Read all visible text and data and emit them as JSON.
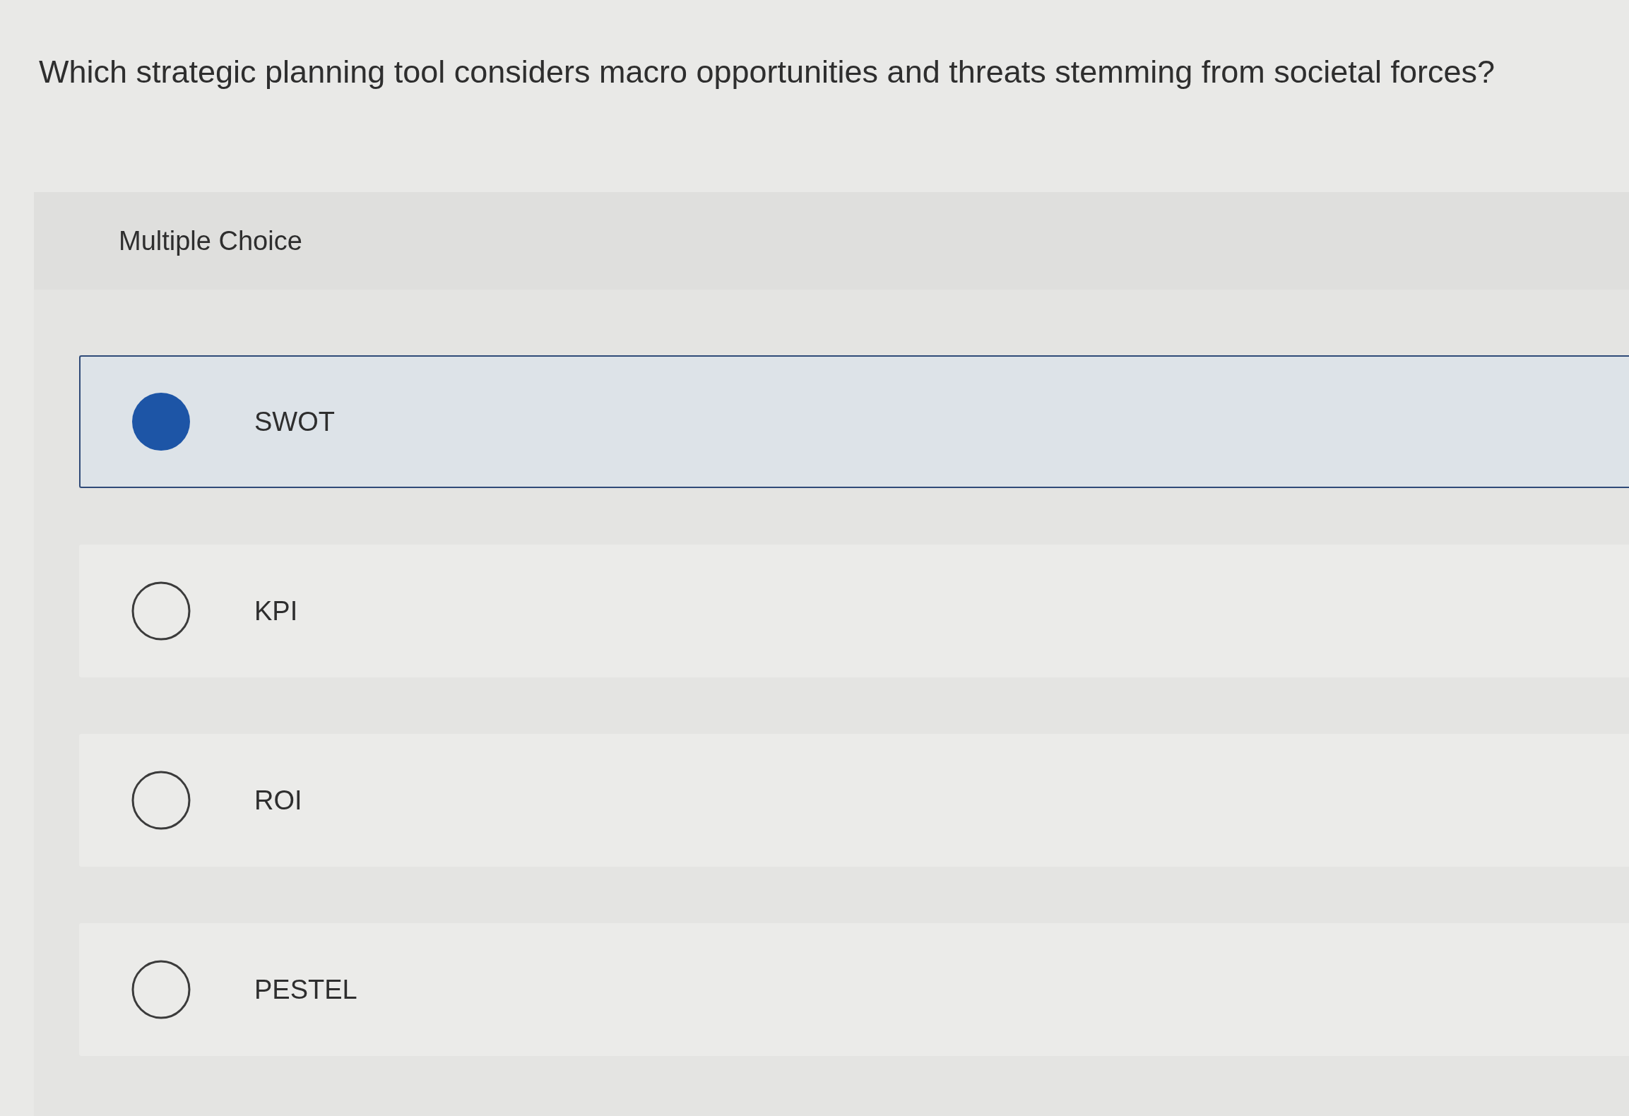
{
  "question": {
    "text": "Which strategic planning tool considers macro opportunities and threats stemming from societal forces?"
  },
  "panel": {
    "label": "Multiple Choice"
  },
  "options": [
    {
      "label": "SWOT",
      "selected": true
    },
    {
      "label": "KPI",
      "selected": false
    },
    {
      "label": "ROI",
      "selected": false
    },
    {
      "label": "PESTEL",
      "selected": false
    }
  ]
}
